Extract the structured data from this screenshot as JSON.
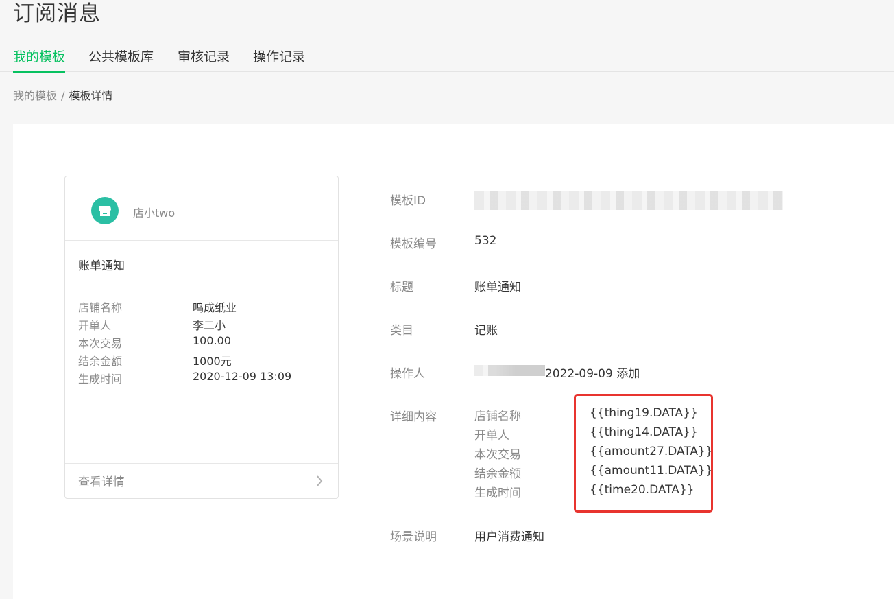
{
  "page": {
    "title": "订阅消息"
  },
  "tabs": [
    {
      "label": "我的模板",
      "active": true
    },
    {
      "label": "公共模板库",
      "active": false
    },
    {
      "label": "审核记录",
      "active": false
    },
    {
      "label": "操作记录",
      "active": false
    }
  ],
  "breadcrumb": {
    "parent": "我的模板",
    "separator": "/",
    "current": "模板详情"
  },
  "preview_card": {
    "shop_name": "店小two",
    "avatar_icon": "shop-icon",
    "title": "账单通知",
    "fields": [
      {
        "key": "店铺名称",
        "value": "鸣成纸业"
      },
      {
        "key": "开单人",
        "value": "李二小"
      },
      {
        "key": "本次交易",
        "value": "100.00"
      },
      {
        "key": "结余金额",
        "value": "1000元"
      },
      {
        "key": "生成时间",
        "value": "2020-12-09 13:09"
      }
    ],
    "footer_label": "查看详情",
    "footer_icon": "chevron-right-icon"
  },
  "detail": {
    "template_id_label": "模板ID",
    "template_no_label": "模板编号",
    "template_no": "532",
    "title_label": "标题",
    "title": "账单通知",
    "category_label": "类目",
    "category": "记账",
    "operator_label": "操作人",
    "operator_action": "2022-09-09 添加",
    "content_label": "详细内容",
    "content": [
      {
        "key": "店铺名称",
        "value": "{{thing19.DATA}}"
      },
      {
        "key": "开单人",
        "value": "{{thing14.DATA}}"
      },
      {
        "key": "本次交易",
        "value": "{{amount27.DATA}}"
      },
      {
        "key": "结余金额",
        "value": "{{amount11.DATA}}"
      },
      {
        "key": "生成时间",
        "value": "{{time20.DATA}}"
      }
    ],
    "scene_label": "场景说明",
    "scene": "用户消费通知"
  },
  "colors": {
    "accent": "#07c160",
    "highlight": "#e8342f",
    "avatar": "#2bbfa4"
  }
}
